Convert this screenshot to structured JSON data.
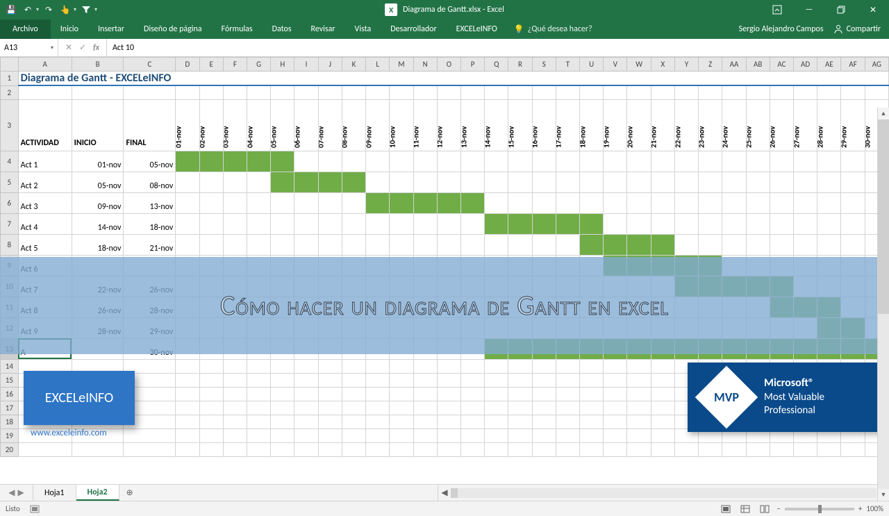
{
  "app": {
    "title": "Diagrama de Gantt.xlsx - Excel",
    "logo_letter": "X"
  },
  "qat": {
    "save": "💾",
    "undo": "↶",
    "redo": "↷",
    "touch": "👆",
    "filter": "▼"
  },
  "win": {
    "ribbon_toggle": "⬆",
    "min": "—",
    "max": "▢",
    "close": "✕"
  },
  "ribbon": {
    "file": "Archivo",
    "tabs": [
      "Inicio",
      "Insertar",
      "Diseño de página",
      "Fórmulas",
      "Datos",
      "Revisar",
      "Vista",
      "Desarrollador",
      "EXCELeINFO"
    ],
    "tell_me_icon": "💡",
    "tell_me": "¿Qué desea hacer?",
    "user": "Sergio Alejandro Campos",
    "share_icon": "👤",
    "share": "Compartir"
  },
  "formula": {
    "name_box": "A13",
    "cancel": "✕",
    "enter": "✓",
    "fx": "fx",
    "value": "Act 10"
  },
  "columns": [
    "A",
    "B",
    "C",
    "D",
    "E",
    "F",
    "G",
    "H",
    "I",
    "J",
    "K",
    "L",
    "M",
    "N",
    "O",
    "P",
    "Q",
    "R",
    "S",
    "T",
    "U",
    "V",
    "W",
    "X",
    "Y",
    "Z",
    "AA",
    "AB",
    "AC",
    "AD",
    "AE",
    "AF",
    "AG"
  ],
  "sheet": {
    "title": "Diagrama de Gantt - EXCELeINFO",
    "headers": {
      "activity": "ACTIVIDAD",
      "start": "INICIO",
      "end": "FINAL"
    },
    "date_headers": [
      "01-nov",
      "02-nov",
      "03-nov",
      "04-nov",
      "05-nov",
      "06-nov",
      "07-nov",
      "08-nov",
      "09-nov",
      "10-nov",
      "11-nov",
      "12-nov",
      "13-nov",
      "14-nov",
      "15-nov",
      "16-nov",
      "17-nov",
      "18-nov",
      "19-nov",
      "20-nov",
      "21-nov",
      "22-nov",
      "23-nov",
      "24-nov",
      "25-nov",
      "26-nov",
      "27-nov",
      "28-nov",
      "29-nov",
      "30-nov"
    ],
    "rows": [
      {
        "n": 4,
        "act": "Act 1",
        "start": "01-nov",
        "end": "05-nov",
        "from": 1,
        "to": 5
      },
      {
        "n": 5,
        "act": "Act 2",
        "start": "05-nov",
        "end": "08-nov",
        "from": 5,
        "to": 8
      },
      {
        "n": 6,
        "act": "Act 3",
        "start": "09-nov",
        "end": "13-nov",
        "from": 9,
        "to": 13
      },
      {
        "n": 7,
        "act": "Act 4",
        "start": "14-nov",
        "end": "18-nov",
        "from": 14,
        "to": 18
      },
      {
        "n": 8,
        "act": "Act 5",
        "start": "18-nov",
        "end": "21-nov",
        "from": 18,
        "to": 21
      },
      {
        "n": 9,
        "act": "Act 6",
        "start": "",
        "end": "",
        "from": 19,
        "to": 23
      },
      {
        "n": 10,
        "act": "Act 7",
        "start": "22-nov",
        "end": "26-nov",
        "from": 22,
        "to": 26
      },
      {
        "n": 11,
        "act": "Act 8",
        "start": "26-nov",
        "end": "28-nov",
        "from": 26,
        "to": 28
      },
      {
        "n": 12,
        "act": "Act 9",
        "start": "28-nov",
        "end": "29-nov",
        "from": 28,
        "to": 29
      },
      {
        "n": 13,
        "act": "A",
        "start": "",
        "end": "30-nov",
        "from": 14,
        "to": 30
      }
    ]
  },
  "overlay": {
    "banner": "Cómo hacer un diagrama de Gantt en excel",
    "badge": "EXCELeINFO",
    "badge_url": "www.exceleinfo.com",
    "mvp_abbr": "MVP",
    "mvp_top": "Microsoft®",
    "mvp_mid": "Most Valuable",
    "mvp_bot": "Professional"
  },
  "tabs": {
    "sheet1": "Hoja1",
    "sheet2": "Hoja2",
    "add": "⊕",
    "nav_l": "◀",
    "nav_r": "▶"
  },
  "status": {
    "ready": "Listo",
    "rec": "⏺",
    "minus": "−",
    "plus": "+",
    "zoom": "100%"
  }
}
